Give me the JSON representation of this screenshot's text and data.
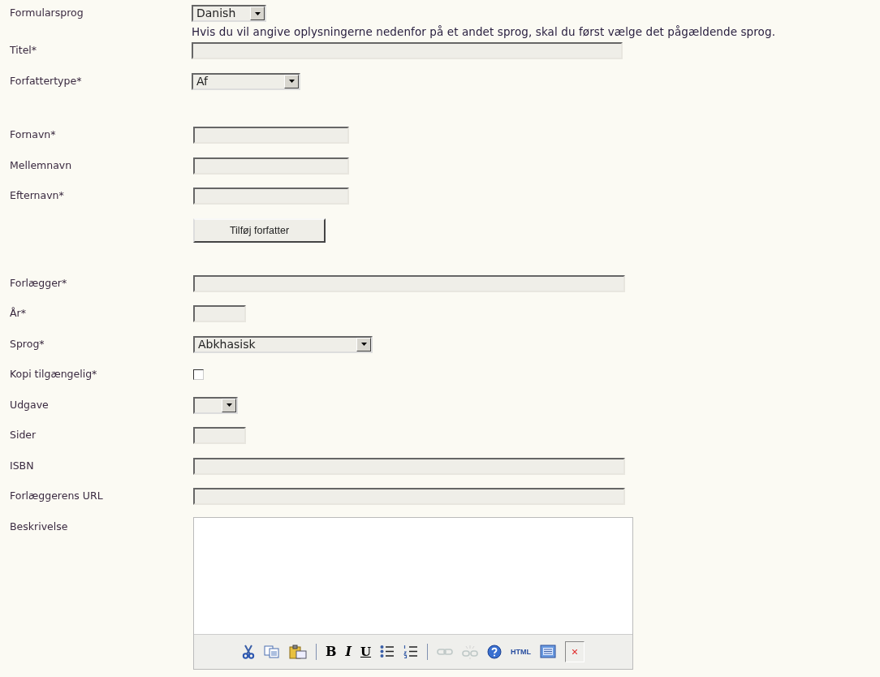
{
  "sections": [
    {
      "rows": [
        {
          "label": "Formularsprog",
          "kind": "select",
          "value": "Danish",
          "hint": "Hvis du vil angive oplysningerne nedenfor på et andet sprog, skal du først vælge det pågældende sprog."
        },
        {
          "label": "Titel*",
          "kind": "long-field"
        },
        {
          "label": "Forfattertype*",
          "kind": "medium-select",
          "value": "Af"
        }
      ]
    },
    {
      "rows": [
        {
          "label": "Fornavn*",
          "kind": "name-field"
        },
        {
          "label": "Mellemnavn",
          "kind": "name-field"
        },
        {
          "label": "Efternavn*",
          "kind": "name-field"
        },
        {
          "kind": "button",
          "text": "Tilføj forfatter"
        }
      ]
    },
    {
      "rows": [
        {
          "label": "Forlægger*",
          "kind": "long-field"
        },
        {
          "label": "År*",
          "kind": "short-field"
        },
        {
          "label": "Sprog*",
          "kind": "wide-select",
          "value": "Abkhasisk"
        },
        {
          "label": "Kopi tilgængelig*",
          "kind": "checkbox",
          "checked": false
        },
        {
          "label": "Udgave",
          "kind": "tiny-select"
        },
        {
          "label": "Sider",
          "kind": "short-field"
        },
        {
          "label": "ISBN",
          "kind": "long-field"
        },
        {
          "label": "Forlæggerens URL",
          "kind": "long-field"
        },
        {
          "label": "Beskrivelse",
          "kind": "editor",
          "tools": [
            {
              "kind": "cut"
            },
            {
              "kind": "copy"
            },
            {
              "kind": "paste"
            },
            {
              "kind": "separator"
            },
            {
              "kind": "bold",
              "text": "B"
            },
            {
              "kind": "italic",
              "text": "I"
            },
            {
              "kind": "underline",
              "text": "U"
            },
            {
              "kind": "bullets"
            },
            {
              "kind": "numbers"
            },
            {
              "kind": "separator"
            },
            {
              "kind": "link",
              "disabled": true
            },
            {
              "kind": "unlink",
              "disabled": true
            },
            {
              "kind": "help"
            },
            {
              "kind": "html",
              "text": "HTML"
            },
            {
              "kind": "source"
            },
            {
              "kind": "close"
            }
          ]
        }
      ]
    }
  ]
}
